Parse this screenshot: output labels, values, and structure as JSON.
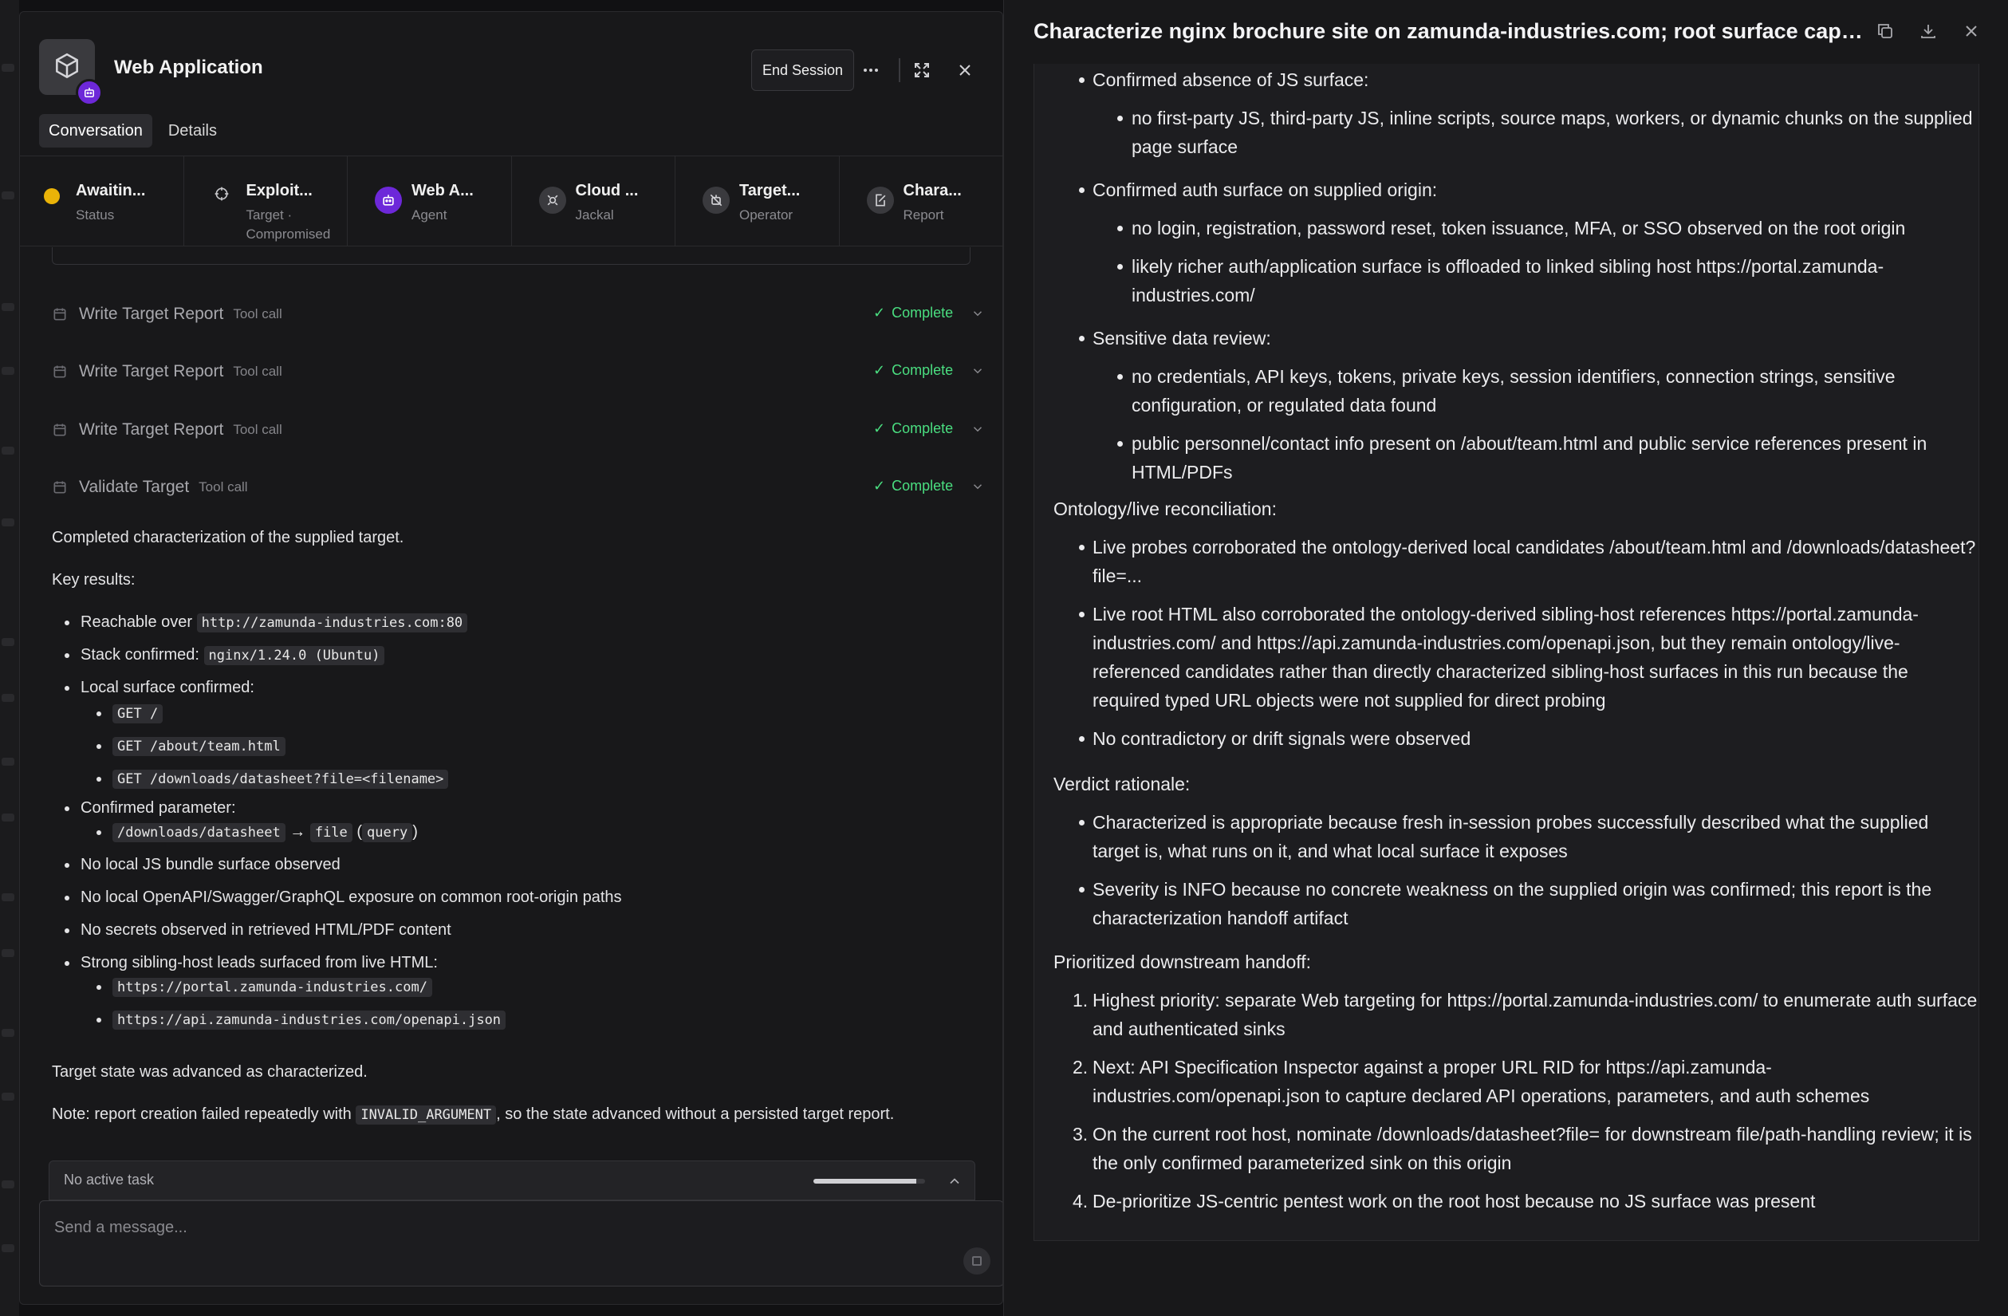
{
  "left_panel": {
    "app_title": "Web Application",
    "end_session_label": "End Session",
    "tabs": [
      {
        "label": "Conversation",
        "active": true
      },
      {
        "label": "Details",
        "active": false
      }
    ],
    "status_strip": [
      {
        "title": "Awaitin...",
        "sub": "Status",
        "icon": "status-dot-icon",
        "color": "#eab308"
      },
      {
        "title": "Exploit...",
        "sub": "Target · Compromised",
        "icon": "target-icon",
        "color": "#9ca3af"
      },
      {
        "title": "Web A...",
        "sub": "Agent",
        "icon": "robot-icon",
        "color": "#6d28d9"
      },
      {
        "title": "Cloud ...",
        "sub": "Jackal",
        "icon": "cloud-icon",
        "color": "#3a3a3e"
      },
      {
        "title": "Target...",
        "sub": "Operator",
        "icon": "operator-icon",
        "color": "#3a3a3e"
      },
      {
        "title": "Chara...",
        "sub": "Report",
        "icon": "report-icon",
        "color": "#3a3a3e"
      }
    ],
    "tool_calls": [
      {
        "name": "Write Target Report",
        "tag": "Tool call",
        "status": "Complete"
      },
      {
        "name": "Write Target Report",
        "tag": "Tool call",
        "status": "Complete"
      },
      {
        "name": "Write Target Report",
        "tag": "Tool call",
        "status": "Complete"
      },
      {
        "name": "Validate Target",
        "tag": "Tool call",
        "status": "Complete"
      }
    ],
    "message": {
      "intro": "Completed characterization of the supplied target.",
      "key_results_label": "Key results:",
      "reachable_prefix": "Reachable over ",
      "reachable_code": "http://zamunda-industries.com:80",
      "stack_prefix": "Stack confirmed: ",
      "stack_code": "nginx/1.24.0 (Ubuntu)",
      "local_surface_label": "Local surface confirmed:",
      "local_surface_items": [
        "GET /",
        "GET /about/team.html",
        "GET /downloads/datasheet?file=<filename>"
      ],
      "param_label": "Confirmed parameter:",
      "param_path": "/downloads/datasheet",
      "param_arrow": "→",
      "param_name": "file",
      "param_open": "(",
      "param_type": "query",
      "param_close": ")",
      "no_js": "No local JS bundle surface observed",
      "no_openapi": "No local OpenAPI/Swagger/GraphQL exposure on common root-origin paths",
      "no_secrets": "No secrets observed in retrieved HTML/PDF content",
      "sibling_label": "Strong sibling-host leads surfaced from live HTML:",
      "sibling_items": [
        "https://portal.zamunda-industries.com/",
        "https://api.zamunda-industries.com/openapi.json"
      ],
      "state_advanced": "Target state was advanced as characterized.",
      "note_prefix": "Note: report creation failed repeatedly with ",
      "note_code": "INVALID_ARGUMENT",
      "note_suffix": ", so the state advanced without a persisted target report."
    },
    "task_bar": {
      "label": "No active task",
      "progress": 0.92
    },
    "composer": {
      "placeholder": "Send a message..."
    }
  },
  "right_panel": {
    "title": "Characterize nginx brochure site on zamunda-industries.com; root surface capt...",
    "sections": {
      "js": {
        "heading": "Confirmed absence of JS surface:",
        "items": [
          "no first-party JS, third-party JS, inline scripts, source maps, workers, or dynamic chunks on the supplied page surface"
        ]
      },
      "auth": {
        "heading": "Confirmed auth surface on supplied origin:",
        "items": [
          "no login, registration, password reset, token issuance, MFA, or SSO observed on the root origin",
          "likely richer auth/application surface is offloaded to linked sibling host https://portal.zamunda-industries.com/"
        ]
      },
      "sensitive": {
        "heading": "Sensitive data review:",
        "items": [
          "no credentials, API keys, tokens, private keys, session identifiers, connection strings, sensitive configuration, or regulated data found",
          "public personnel/contact info present on /about/team.html and public service references present in HTML/PDFs"
        ]
      },
      "ontology": {
        "heading": "Ontology/live reconciliation:",
        "items": [
          "Live probes corroborated the ontology-derived local candidates /about/team.html and /downloads/datasheet?file=...",
          "Live root HTML also corroborated the ontology-derived sibling-host references https://portal.zamunda-industries.com/ and https://api.zamunda-industries.com/openapi.json, but they remain ontology/live-referenced candidates rather than directly characterized sibling-host surfaces in this run because the required typed URL objects were not supplied for direct probing",
          "No contradictory or drift signals were observed"
        ]
      },
      "verdict": {
        "heading": "Verdict rationale:",
        "items": [
          "Characterized is appropriate because fresh in-session probes successfully described what the supplied target is, what runs on it, and what local surface it exposes",
          "Severity is INFO because no concrete weakness on the supplied origin was confirmed; this report is the characterization handoff artifact"
        ]
      },
      "handoff": {
        "heading": "Prioritized downstream handoff:",
        "items": [
          "Highest priority: separate Web targeting for https://portal.zamunda-industries.com/ to enumerate auth surface and authenticated sinks",
          "Next: API Specification Inspector against a proper URL RID for https://api.zamunda-industries.com/openapi.json to capture declared API operations, parameters, and auth schemes",
          "On the current root host, nominate /downloads/datasheet?file= for downstream file/path-handling review; it is the only confirmed parameterized sink on this origin",
          "De-prioritize JS-centric pentest work on the root host because no JS surface was present"
        ]
      }
    }
  }
}
